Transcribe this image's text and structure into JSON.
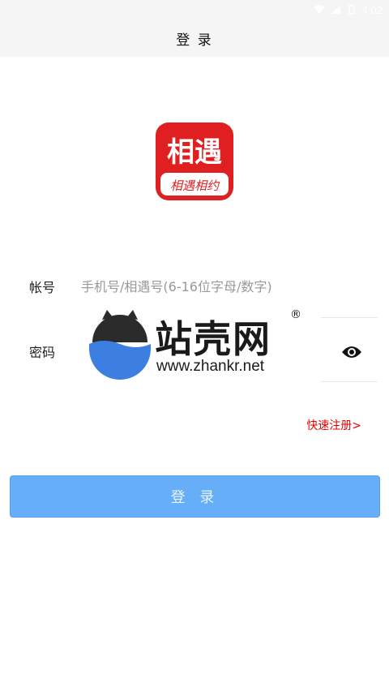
{
  "status_bar": {
    "time": "4:02"
  },
  "header": {
    "title": "登 录"
  },
  "logo": {
    "main_text": "相遇",
    "sub_text": "相遇相约",
    "color": "#e02020"
  },
  "form": {
    "account": {
      "label": "帐号",
      "placeholder": "手机号/相遇号(6-16位字母/数字)",
      "value": ""
    },
    "password": {
      "label": "密码",
      "placeholder": "",
      "value": ""
    }
  },
  "register_link": "快速注册>",
  "login_button": "登 录",
  "watermark": {
    "cn": "站壳网",
    "en": "www.zhankr.net",
    "reg": "®"
  },
  "colors": {
    "accent": "#66aef8",
    "link": "#e60000"
  }
}
